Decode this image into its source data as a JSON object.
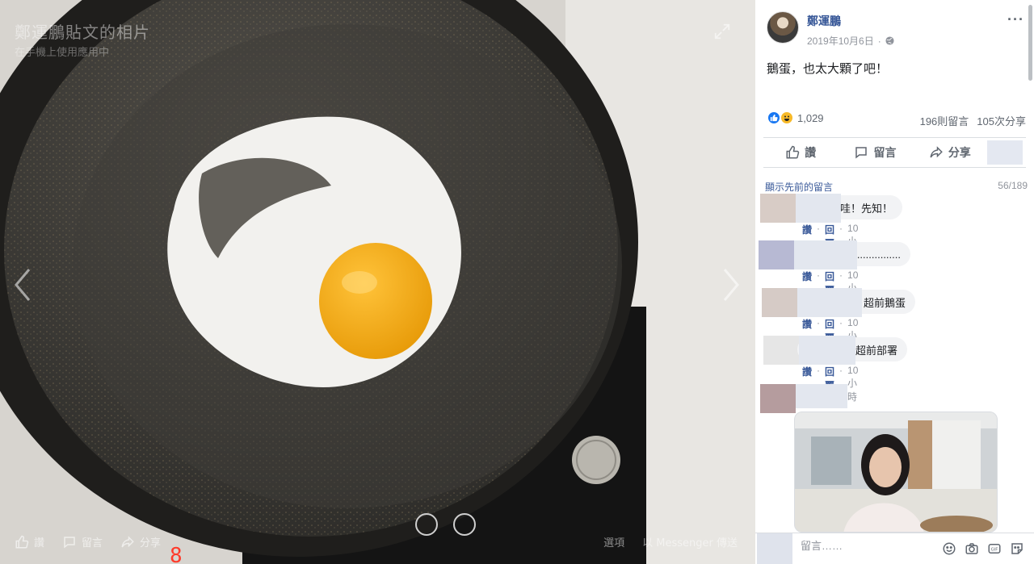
{
  "viewer": {
    "title": "鄭運鵬貼文的相片",
    "subtitle": "在手機上使用應用中",
    "actions": [
      {
        "label": "讚",
        "icon": "like-icon"
      },
      {
        "label": "留言",
        "icon": "comment-icon"
      },
      {
        "label": "分享",
        "icon": "share-icon"
      }
    ],
    "options_label": "選項",
    "messenger_label": "以 Messenger 傳送",
    "icons": {
      "expand": "expand-icon",
      "prev": "chevron-left-icon",
      "next": "chevron-right-icon"
    }
  },
  "post": {
    "author": "鄭運鵬",
    "date": "2019年10月6日",
    "privacy_icon": "globe-icon",
    "more_icon": "more-icon",
    "text": "鵝蛋，也太大顆了吧！",
    "reaction_count": "1,029",
    "reaction_types": [
      "like",
      "haha"
    ],
    "comment_count": "196則留言",
    "share_count": "105次分享"
  },
  "action_bar": {
    "like": "讚",
    "comment": "留言",
    "share": "分享"
  },
  "comments": {
    "show_previous": "顯示先前的留言",
    "page_count": "56/189",
    "items": [
      {
        "text": "哇！先知！",
        "like": "讚",
        "reply": "回覆",
        "time": "10小時"
      },
      {
        "text": "...............",
        "like": "讚",
        "reply": "回覆",
        "time": "10小時"
      },
      {
        "text": "超前鵝蛋",
        "like": "讚",
        "reply": "回覆",
        "time": "10小時"
      },
      {
        "text": "超前部署",
        "like": "讚",
        "reply": "回覆",
        "time": "10小時"
      }
    ]
  },
  "composer": {
    "placeholder": "留言……",
    "icons": [
      "emoji-icon",
      "camera-icon",
      "gif-icon",
      "sticker-icon"
    ]
  },
  "colors": {
    "link": "#385898",
    "like_blue": "#1877f2",
    "haha_yellow": "#f7b928",
    "meta_grey": "#90949c"
  }
}
